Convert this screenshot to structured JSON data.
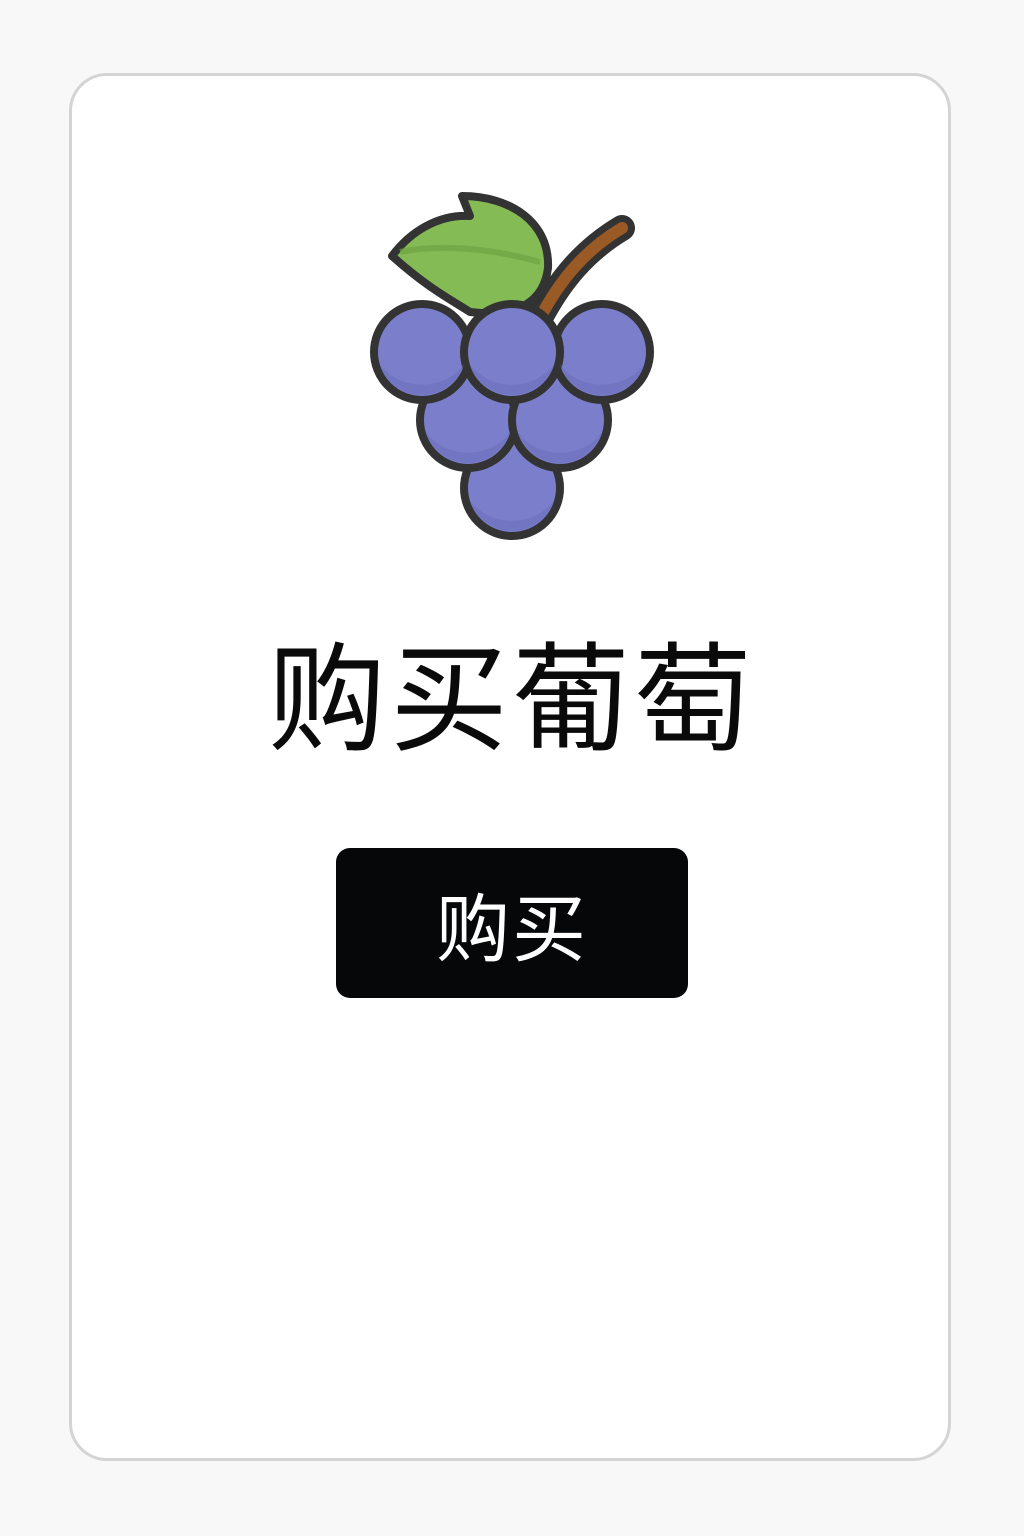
{
  "product": {
    "icon": "grape-icon",
    "title": "购买葡萄"
  },
  "actions": {
    "buy_label": "购买"
  },
  "colors": {
    "grape": "#7b7fcb",
    "leaf": "#84bb55",
    "stem": "#9a5a26",
    "outline": "#333333",
    "button_bg": "#050709",
    "button_text": "#ffffff",
    "card_border": "#d4d4d4"
  }
}
